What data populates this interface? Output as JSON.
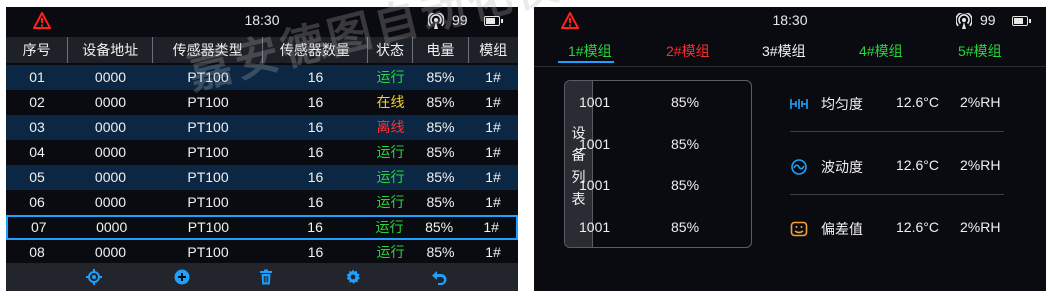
{
  "left": {
    "status": {
      "time": "18:30",
      "battery_pct": "99"
    },
    "columns": [
      "序号",
      "设备地址",
      "传感器类型",
      "传感器数量",
      "状态",
      "电量",
      "模组"
    ],
    "rows": [
      {
        "no": "01",
        "addr": "0000",
        "type": "PT100",
        "count": "16",
        "status": "运行",
        "power": "85%",
        "module": "1#"
      },
      {
        "no": "02",
        "addr": "0000",
        "type": "PT100",
        "count": "16",
        "status": "在线",
        "power": "85%",
        "module": "1#"
      },
      {
        "no": "03",
        "addr": "0000",
        "type": "PT100",
        "count": "16",
        "status": "离线",
        "power": "85%",
        "module": "1#"
      },
      {
        "no": "04",
        "addr": "0000",
        "type": "PT100",
        "count": "16",
        "status": "运行",
        "power": "85%",
        "module": "1#"
      },
      {
        "no": "05",
        "addr": "0000",
        "type": "PT100",
        "count": "16",
        "status": "运行",
        "power": "85%",
        "module": "1#"
      },
      {
        "no": "06",
        "addr": "0000",
        "type": "PT100",
        "count": "16",
        "status": "运行",
        "power": "85%",
        "module": "1#"
      },
      {
        "no": "07",
        "addr": "0000",
        "type": "PT100",
        "count": "16",
        "status": "运行",
        "power": "85%",
        "module": "1#"
      },
      {
        "no": "08",
        "addr": "0000",
        "type": "PT100",
        "count": "16",
        "status": "运行",
        "power": "85%",
        "module": "1#"
      }
    ],
    "toolbar_icons": [
      "locate-icon",
      "add-icon",
      "trash-icon",
      "gear-icon",
      "back-icon"
    ]
  },
  "right": {
    "status": {
      "time": "18:30",
      "battery_pct": "99"
    },
    "tabs": [
      {
        "label": "1#模组",
        "color": "#27d53a"
      },
      {
        "label": "2#模组",
        "color": "#ff2b2b"
      },
      {
        "label": "3#模组",
        "color": "#f0f0f0"
      },
      {
        "label": "4#模组",
        "color": "#27d53a"
      },
      {
        "label": "5#模组",
        "color": "#27d53a"
      }
    ],
    "device_list_title": "设备列表",
    "devices": [
      {
        "id": "1001",
        "value": "85%"
      },
      {
        "id": "1001",
        "value": "85%"
      },
      {
        "id": "1001",
        "value": "85%"
      },
      {
        "id": "1001",
        "value": "85%"
      }
    ],
    "metrics": [
      {
        "icon": "uniformity-icon",
        "label": "均匀度",
        "temp": "12.6°C",
        "rh": "2%RH"
      },
      {
        "icon": "fluctuation-icon",
        "label": "波动度",
        "temp": "12.6°C",
        "rh": "2%RH"
      },
      {
        "icon": "deviation-icon",
        "label": "偏差值",
        "temp": "12.6°C",
        "rh": "2%RH"
      }
    ]
  },
  "watermark": "嘉安德图自动化仪器有限公司",
  "colors": {
    "accent": "#1ea0ff",
    "alarm": "#ff2b2b",
    "running": "#27d53a",
    "online": "#f2d22a",
    "row_stripe": "#0b2744"
  }
}
